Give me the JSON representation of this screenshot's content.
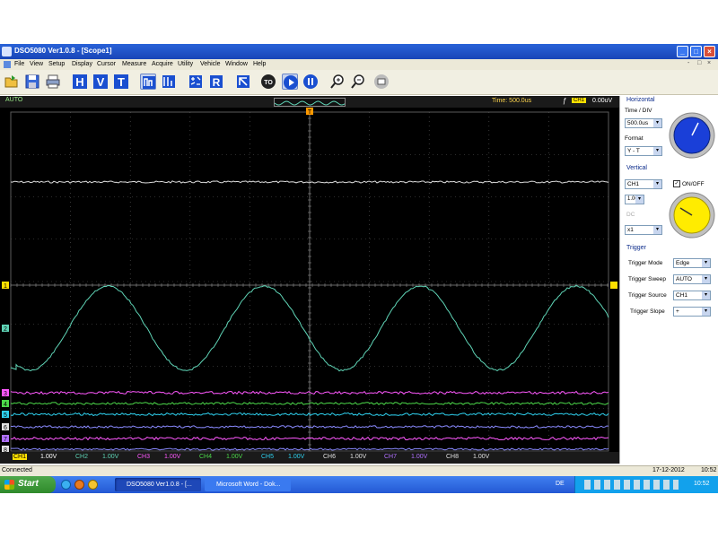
{
  "window": {
    "title": "DSO5080 Ver1.0.8 - [Scope1]",
    "controls": [
      "_",
      "□",
      "×"
    ]
  },
  "menu": {
    "items": [
      "File",
      "View",
      "Setup",
      "Display",
      "Cursor",
      "Measure",
      "Acquire",
      "Utility",
      "Vehicle",
      "Window",
      "Help"
    ],
    "mdi_controls": [
      "-",
      "□",
      "×"
    ]
  },
  "toolbar": {
    "buttons": [
      "open-icon",
      "save-icon",
      "print-icon",
      "h-cursor-icon",
      "v-cursor-icon",
      "t-cursor-icon",
      "channel-icon",
      "measure-icon",
      "math-icon",
      "reference-icon",
      "record-icon",
      "auto-setup-icon",
      "run-icon",
      "stop-icon",
      "zoom-in-icon",
      "zoom-out-icon",
      "print-screen-icon"
    ],
    "letters": {
      "h": "H",
      "v": "V",
      "t": "T",
      "r": "R",
      "m": "M",
      "s": "S",
      "to": "TO"
    }
  },
  "scope_header": {
    "mode": "AUTO",
    "time": "Time: 500.0us",
    "trigger_channel": "CH1",
    "trigger_value": "0.00uV"
  },
  "channels": [
    {
      "label": "CH1",
      "value": "1.00V",
      "color": "#ffe100"
    },
    {
      "label": "CH2",
      "value": "1.00V",
      "color": "#5fd4b6"
    },
    {
      "label": "CH3",
      "value": "1.00V",
      "color": "#ff58ff"
    },
    {
      "label": "CH4",
      "value": "1.00V",
      "color": "#4cd94a"
    },
    {
      "label": "CH5",
      "value": "1.00V",
      "color": "#2ed0ee"
    },
    {
      "label": "CH6",
      "value": "1.00V",
      "color": "#e0e0e0"
    },
    {
      "label": "CH7",
      "value": "1.00V",
      "color": "#b070ff"
    },
    {
      "label": "CH8",
      "value": "1.00V",
      "color": "#e0e0e0"
    }
  ],
  "channel_markers": [
    "1",
    "2",
    "3",
    "4",
    "5",
    "6",
    "7",
    "8"
  ],
  "trigger_marker": "T",
  "panel": {
    "horizontal": {
      "title": "Horizontal",
      "timediv_label": "Time / DIV",
      "timediv_value": "500.0us",
      "format_label": "Format",
      "format_value": "Y - T"
    },
    "vertical": {
      "title": "Vertical",
      "channel": "CH1",
      "onoff_label": "ON/OFF",
      "volts": "1.00V",
      "coupling": "DC",
      "probe": "x1"
    },
    "trigger": {
      "title": "Trigger",
      "rows": [
        {
          "label": "Trigger Mode",
          "value": "Edge"
        },
        {
          "label": "Trigger Sweep",
          "value": "AUTO"
        },
        {
          "label": "Trigger Source",
          "value": "CH1"
        },
        {
          "label": "Trigger Slope",
          "value": "+"
        }
      ]
    }
  },
  "status": {
    "text": "Connected",
    "date": "17-12-2012",
    "time": "10:52"
  },
  "taskbar": {
    "start": "Start",
    "tasks": [
      "DSO5080 Ver1.0.8 - [...",
      "Microsoft Word - Dok..."
    ],
    "lang": "DE",
    "clock": "10:52"
  },
  "colors": {
    "ch1": "#ffe100",
    "ch2": "#5fd4b6",
    "ch3": "#ff58ff",
    "ch4": "#4cd94a",
    "ch5": "#2ed0ee",
    "grid": "#5a5a5a",
    "horizontal_knob": "#1a3fd8",
    "vertical_knob": "#ffec00"
  }
}
